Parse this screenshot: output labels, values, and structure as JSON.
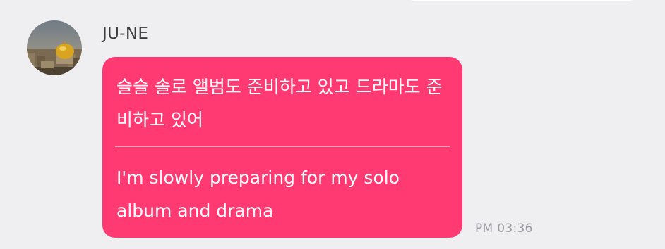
{
  "chat": {
    "message": {
      "sender_name": "JU-NE",
      "avatar_icon": "avatar-photo-icon",
      "text_korean": "슬슬 솔로 앨범도 준비하고 있고 드라마도 준비하고 있어",
      "text_english": "I'm slowly preparing for my solo album and drama",
      "time": "PM 03:36",
      "bubble_color": "#ff3a73"
    }
  }
}
